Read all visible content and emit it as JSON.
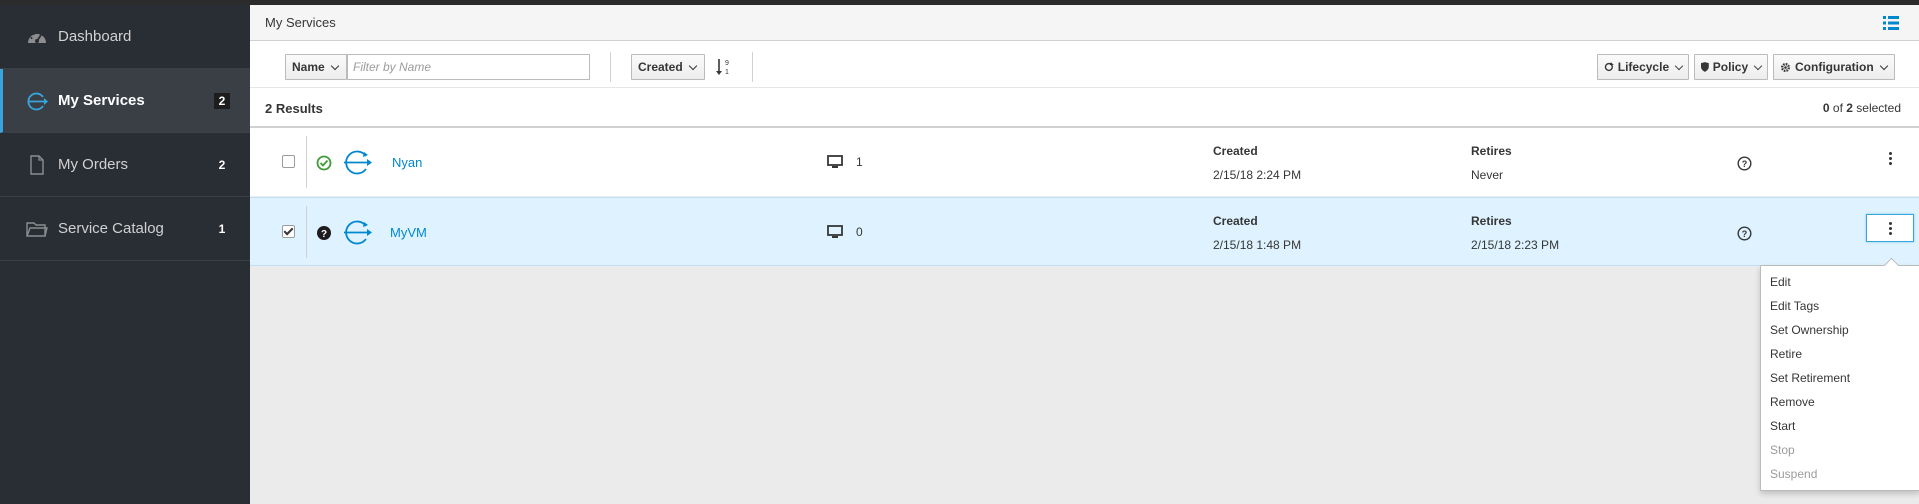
{
  "sidebar": {
    "items": [
      {
        "label": "Dashboard",
        "badge": "",
        "icon": "dashboard-icon"
      },
      {
        "label": "My Services",
        "badge": "2",
        "icon": "services-icon"
      },
      {
        "label": "My Orders",
        "badge": "2",
        "icon": "orders-icon"
      },
      {
        "label": "Service Catalog",
        "badge": "1",
        "icon": "catalog-icon"
      }
    ]
  },
  "header": {
    "title": "My Services",
    "view_icon": "list-view-icon"
  },
  "toolbar": {
    "filter_field": "Name",
    "filter_placeholder": "Filter by Name",
    "sort_field": "Created",
    "sort_icon": "sort-numeric-asc-icon",
    "actions": {
      "lifecycle": "Lifecycle",
      "policy": "Policy",
      "configuration": "Configuration"
    }
  },
  "results": {
    "count_label": "2 Results",
    "selected_num": "0",
    "selected_of": "of",
    "selected_total": "2",
    "selected_label": "selected"
  },
  "rows": [
    {
      "name": "Nyan",
      "status": "ok",
      "vms": "1",
      "created_label": "Created",
      "created": "2/15/18 2:24 PM",
      "retires_label": "Retires",
      "retires": "Never",
      "checked": false
    },
    {
      "name": "MyVM",
      "status": "unknown",
      "vms": "0",
      "created_label": "Created",
      "created": "2/15/18 1:48 PM",
      "retires_label": "Retires",
      "retires": "2/15/18 2:23 PM",
      "checked": true
    }
  ],
  "menu": {
    "items": [
      {
        "label": "Edit",
        "enabled": true
      },
      {
        "label": "Edit Tags",
        "enabled": true
      },
      {
        "label": "Set Ownership",
        "enabled": true
      },
      {
        "label": "Retire",
        "enabled": true
      },
      {
        "label": "Set Retirement",
        "enabled": true
      },
      {
        "label": "Remove",
        "enabled": true
      },
      {
        "label": "Start",
        "enabled": true
      },
      {
        "label": "Stop",
        "enabled": false
      },
      {
        "label": "Suspend",
        "enabled": false
      }
    ]
  },
  "colors": {
    "accent": "#0088ce",
    "sidebar_bg": "#292e34",
    "active_border": "#39a5dc",
    "selected_row": "#def3ff",
    "ok_green": "#3f9c35"
  }
}
